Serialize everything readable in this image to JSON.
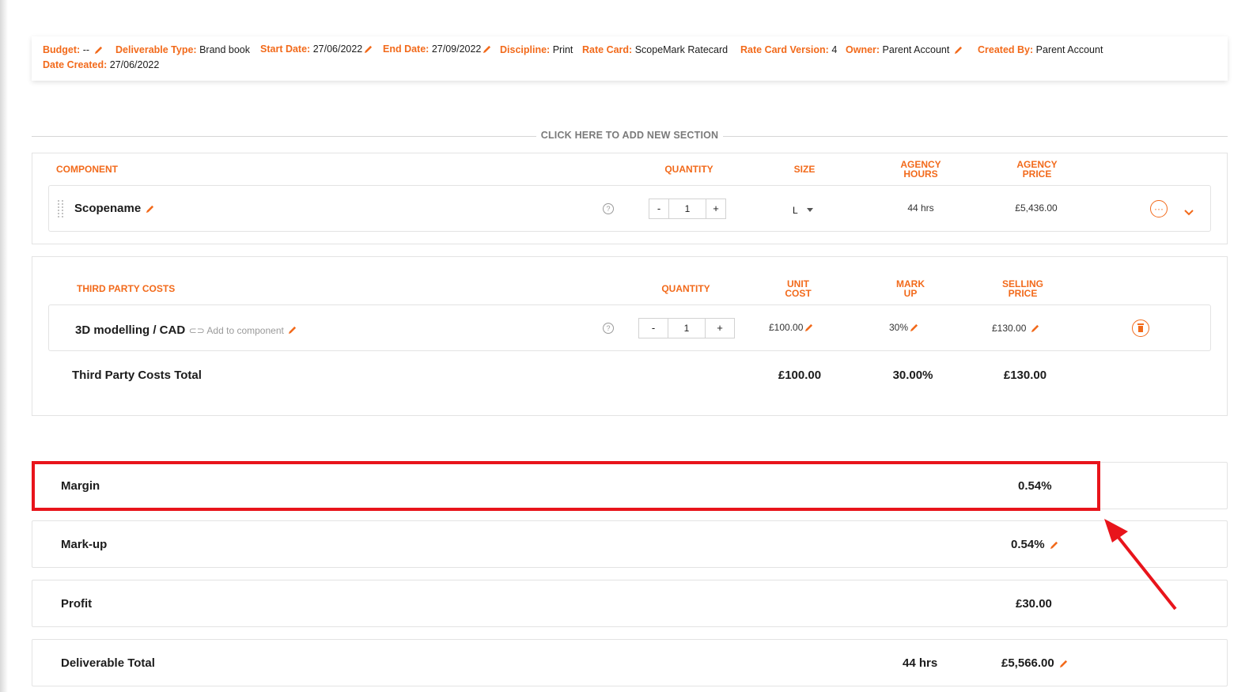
{
  "meta": {
    "budget_label": "Budget:",
    "budget_value": "--",
    "deliverable_type_label": "Deliverable Type:",
    "deliverable_type_value": "Brand book",
    "start_date_label": "Start Date:",
    "start_date_value": "27/06/2022",
    "end_date_label": "End Date:",
    "end_date_value": "27/09/2022",
    "discipline_label": "Discipline:",
    "discipline_value": "Print",
    "rate_card_label": "Rate Card:",
    "rate_card_value": "ScopeMark Ratecard",
    "rate_card_version_label": "Rate Card Version:",
    "rate_card_version_value": "4",
    "owner_label": "Owner:",
    "owner_value": "Parent Account",
    "created_by_label": "Created By:",
    "created_by_value": "Parent Account",
    "date_created_label": "Date Created:",
    "date_created_value": "27/06/2022"
  },
  "add_section": "CLICK HERE TO ADD NEW SECTION",
  "components": {
    "headers": {
      "component": "COMPONENT",
      "quantity": "QUANTITY",
      "size": "SIZE",
      "agency_hours_1": "AGENCY",
      "agency_hours_2": "HOURS",
      "agency_price_1": "AGENCY",
      "agency_price_2": "PRICE"
    },
    "row": {
      "name": "Scopename",
      "help": "?",
      "minus": "-",
      "quantity": "1",
      "plus": "+",
      "size": "L",
      "hours": "44 hrs",
      "price": "£5,436.00",
      "more": "···"
    }
  },
  "third_party": {
    "headers": {
      "title": "THIRD PARTY COSTS",
      "quantity": "QUANTITY",
      "unit_cost_1": "UNIT",
      "unit_cost_2": "COST",
      "mark_up_1": "MARK",
      "mark_up_2": "UP",
      "selling_price_1": "SELLING",
      "selling_price_2": "PRICE"
    },
    "row": {
      "name": "3D modelling / CAD",
      "link": "Add to component",
      "help": "?",
      "minus": "-",
      "quantity": "1",
      "plus": "+",
      "unit_cost": "£100.00",
      "mark_up": "30%",
      "selling_price": "£130.00"
    },
    "total": {
      "label": "Third Party Costs Total",
      "unit_cost": "£100.00",
      "mark_up": "30.00%",
      "selling_price": "£130.00"
    }
  },
  "summary": {
    "margin_label": "Margin",
    "margin_value": "0.54%",
    "markup_label": "Mark-up",
    "markup_value": "0.54%",
    "profit_label": "Profit",
    "profit_value": "£30.00",
    "total_label": "Deliverable Total",
    "total_hours": "44 hrs",
    "total_value": "£5,566.00"
  },
  "colors": {
    "accent": "#f26a1b",
    "highlight": "#e8141b"
  }
}
